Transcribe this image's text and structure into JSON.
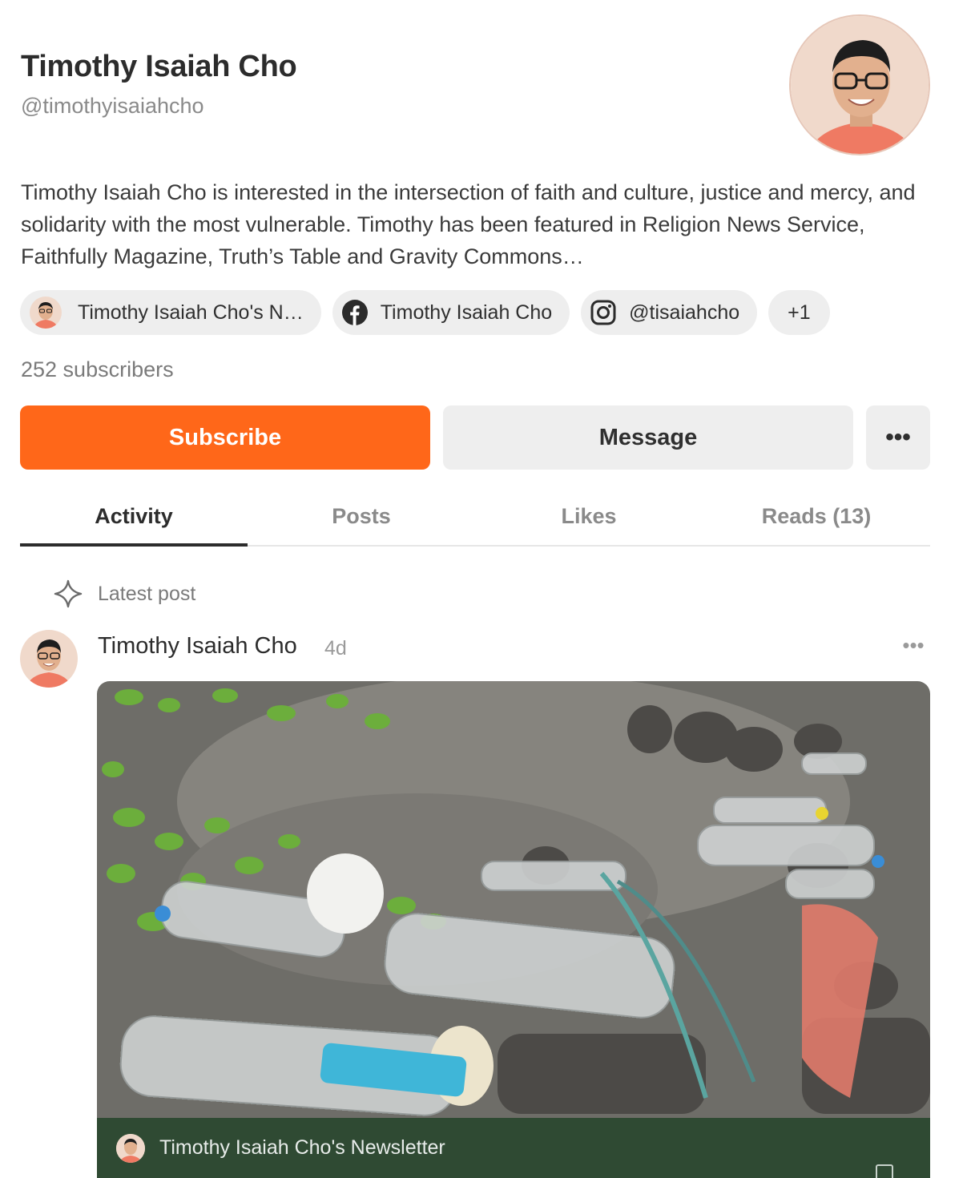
{
  "profile": {
    "name": "Timothy Isaiah Cho",
    "handle": "@timothyisaiahcho",
    "bio": "Timothy Isaiah Cho is interested in the intersection of faith and culture, justice and mercy, and solidarity with the most vulnerable. Timothy has been featured in Religion News Service, Faithfully Magazine, Truth’s Table and Gravity Commons…",
    "subscribers": "252 subscribers"
  },
  "chips": [
    {
      "label": "Timothy Isaiah Cho's N…",
      "icon": "avatar"
    },
    {
      "label": "Timothy Isaiah Cho",
      "icon": "facebook-icon"
    },
    {
      "label": "@tisaiahcho",
      "icon": "instagram-icon"
    },
    {
      "label": "+1"
    }
  ],
  "actions": {
    "subscribe": "Subscribe",
    "message": "Message",
    "more": "•••"
  },
  "tabs": [
    {
      "label": "Activity",
      "active": true
    },
    {
      "label": "Posts",
      "active": false
    },
    {
      "label": "Likes",
      "active": false
    },
    {
      "label": "Reads (13)",
      "active": false
    }
  ],
  "feed": {
    "section_label": "Latest post",
    "post": {
      "author": "Timothy Isaiah Cho",
      "time": "4d",
      "more": "•••",
      "publication": "Timothy Isaiah Cho's Newsletter"
    }
  },
  "colors": {
    "accent": "#ff6719",
    "footer": "#2f4a33"
  }
}
